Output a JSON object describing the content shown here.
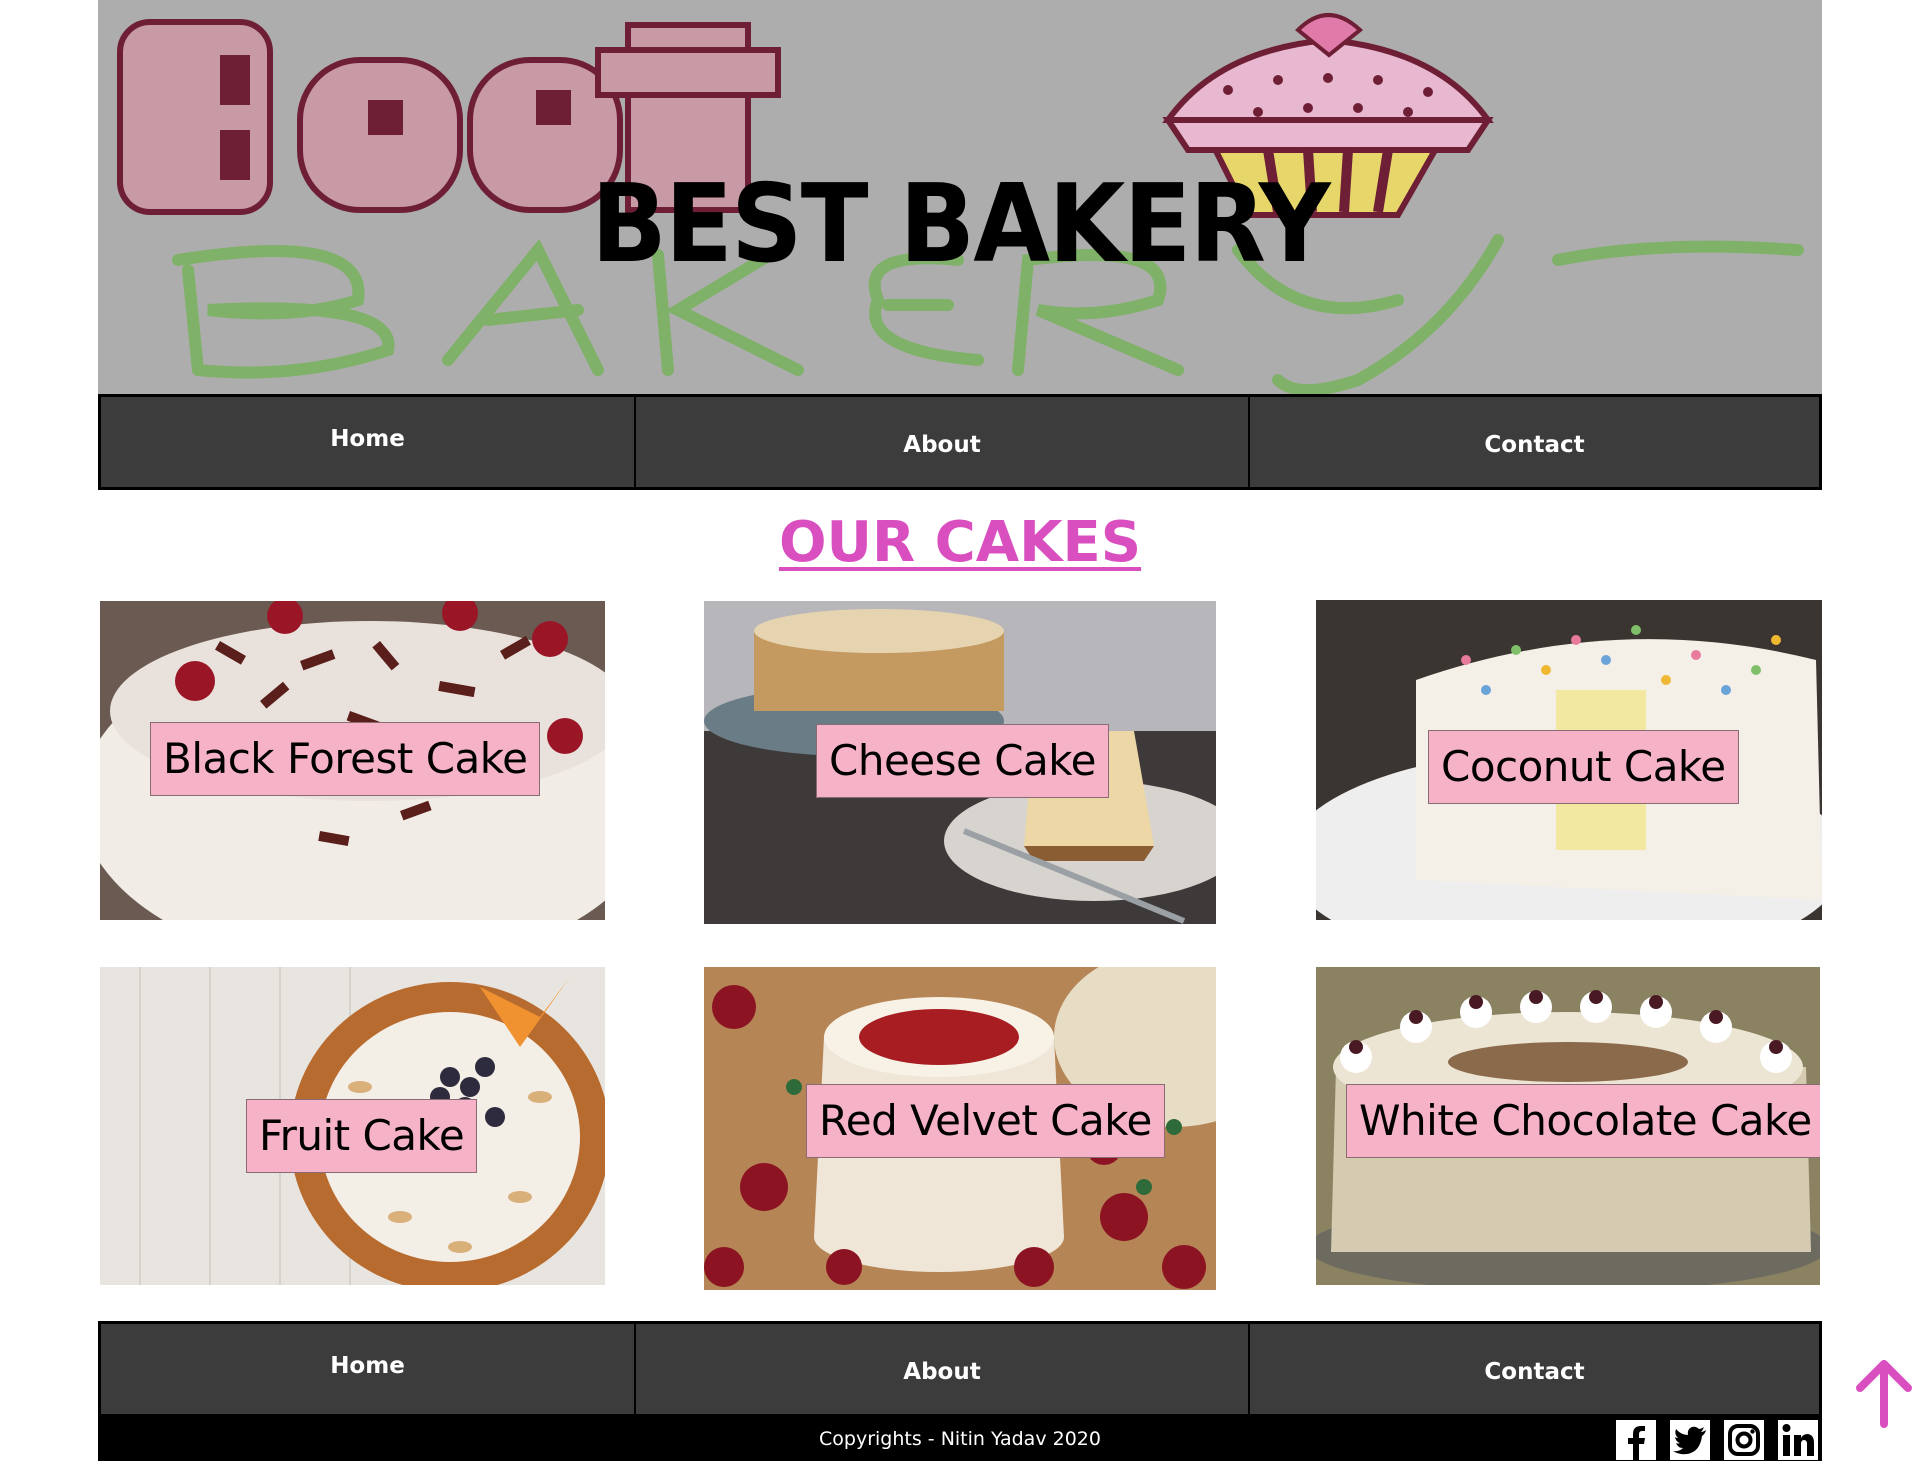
{
  "site": {
    "title": "BEST BAKERY",
    "logo_icon": "best-bakery-cupcake-logo",
    "banner_color": "#adadad"
  },
  "nav": {
    "home": "Home",
    "about": "About",
    "contact": "Contact"
  },
  "main": {
    "heading": "OUR CAKES",
    "heading_color": "#d94fbf",
    "cakes": [
      {
        "name": "Black Forest Cake"
      },
      {
        "name": "Cheese Cake"
      },
      {
        "name": "Coconut Cake"
      },
      {
        "name": "Fruit Cake"
      },
      {
        "name": "Red Velvet Cake"
      },
      {
        "name": "White Chocolate Cake"
      }
    ],
    "label_color": "#f6b3c8"
  },
  "footer": {
    "copyright": "Copyrights - Nitin Yadav 2020",
    "social": [
      {
        "icon": "facebook-icon",
        "glyph": "f"
      },
      {
        "icon": "twitter-icon",
        "glyph": "t"
      },
      {
        "icon": "instagram-icon",
        "glyph": "◎"
      },
      {
        "icon": "linkedin-icon",
        "glyph": "in"
      }
    ]
  },
  "scroll_top": {
    "icon": "arrow-up-icon",
    "color": "#d94fbf"
  }
}
